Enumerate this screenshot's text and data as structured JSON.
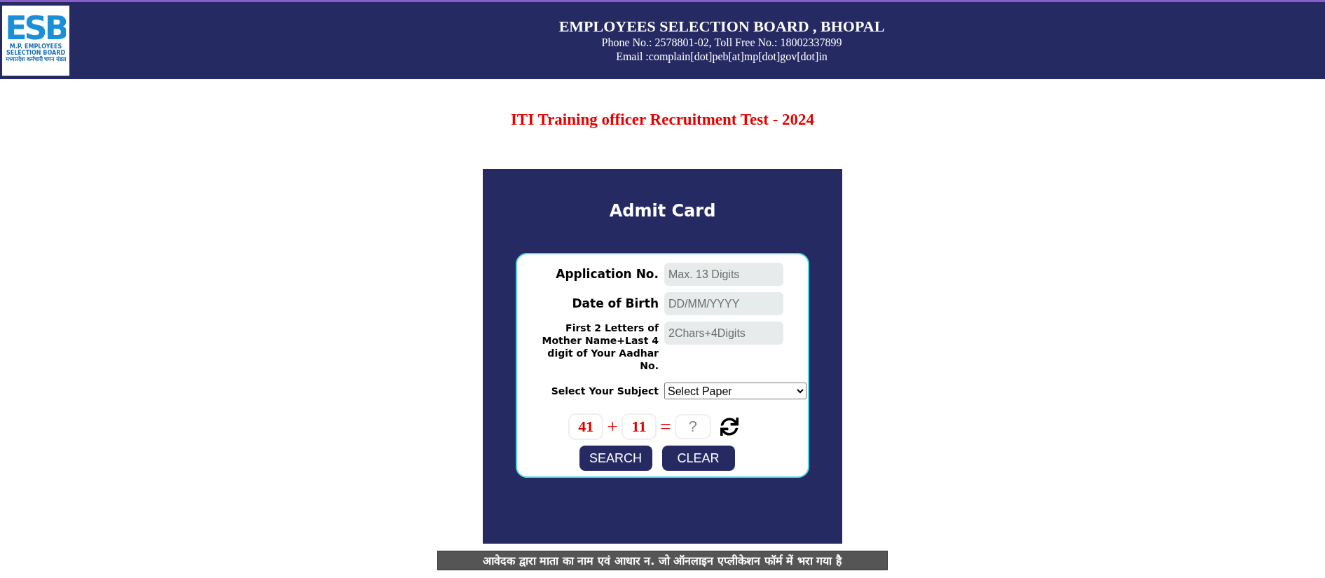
{
  "header": {
    "logo": {
      "letters": "ESB",
      "caption": "M.P. EMPLOYEES SELECTION BOARD",
      "caption_hindi": "मध्यप्रदेश कर्मचारी चयन मंडल"
    },
    "title": "EMPLOYEES SELECTION BOARD , BHOPAL",
    "phone": "Phone No.: 2578801-02, Toll Free No.: 18002337899",
    "email": "Email :complain[dot]peb[at]mp[dot]gov[dot]in"
  },
  "page_title": "ITI Training officer Recruitment Test - 2024",
  "panel": {
    "title": "Admit Card",
    "fields": [
      {
        "kind": "input",
        "label": "Application No.",
        "placeholder": "Max. 13 Digits"
      },
      {
        "kind": "input",
        "label": "Date of Birth",
        "placeholder": "DD/MM/YYYY"
      },
      {
        "kind": "input",
        "label": "First 2 Letters of Mother Name+Last 4 digit of Your Aadhar No.",
        "placeholder": "2Chars+4Digits"
      },
      {
        "kind": "select",
        "label": "Select Your Subject",
        "value": "Select Paper"
      }
    ],
    "captcha": {
      "first": "41",
      "operator": "+",
      "second": "11",
      "equals": "=",
      "placeholder": "?"
    },
    "buttons": [
      "SEARCH",
      "CLEAR"
    ]
  },
  "notice": "आवेदक द्वारा माता का नाम एवं आधार न. जो ऑनलाइन एप्लीकेशन फॉर्म में भरा गया है"
}
